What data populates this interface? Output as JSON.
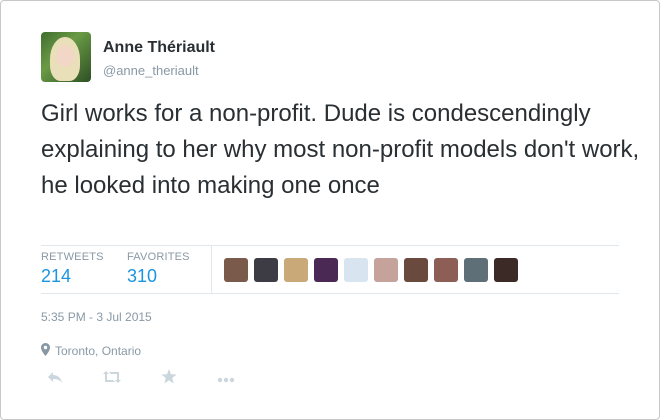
{
  "author": {
    "name": "Anne Thériault",
    "handle": "@anne_theriault"
  },
  "tweet": {
    "text": "Girl works for a non-profit. Dude is condescendingly explaining to her why most non-profit models don't work, he looked into making one once"
  },
  "stats": {
    "retweets_label": "RETWEETS",
    "retweets_count": "214",
    "favorites_label": "FAVORITES",
    "favorites_count": "310"
  },
  "favoriters": [
    {
      "color": "#7a5a4a"
    },
    {
      "color": "#3d3b44"
    },
    {
      "color": "#c9a978"
    },
    {
      "color": "#4a2a55"
    },
    {
      "color": "#d8e4ef"
    },
    {
      "color": "#c6a39a"
    },
    {
      "color": "#6b4a3e"
    },
    {
      "color": "#8c5e55"
    },
    {
      "color": "#5f6f78"
    },
    {
      "color": "#3c2a26"
    }
  ],
  "timestamp": "5:35 PM - 3 Jul 2015",
  "location": "Toronto, Ontario",
  "icons": {
    "reply": "reply-icon",
    "retweet": "retweet-icon",
    "favorite": "star-icon",
    "more": "more-icon",
    "location": "map-pin-icon"
  },
  "colors": {
    "link": "#1b95e0",
    "muted": "#8899a6",
    "text": "#292f33",
    "action": "#ccd6dd"
  }
}
